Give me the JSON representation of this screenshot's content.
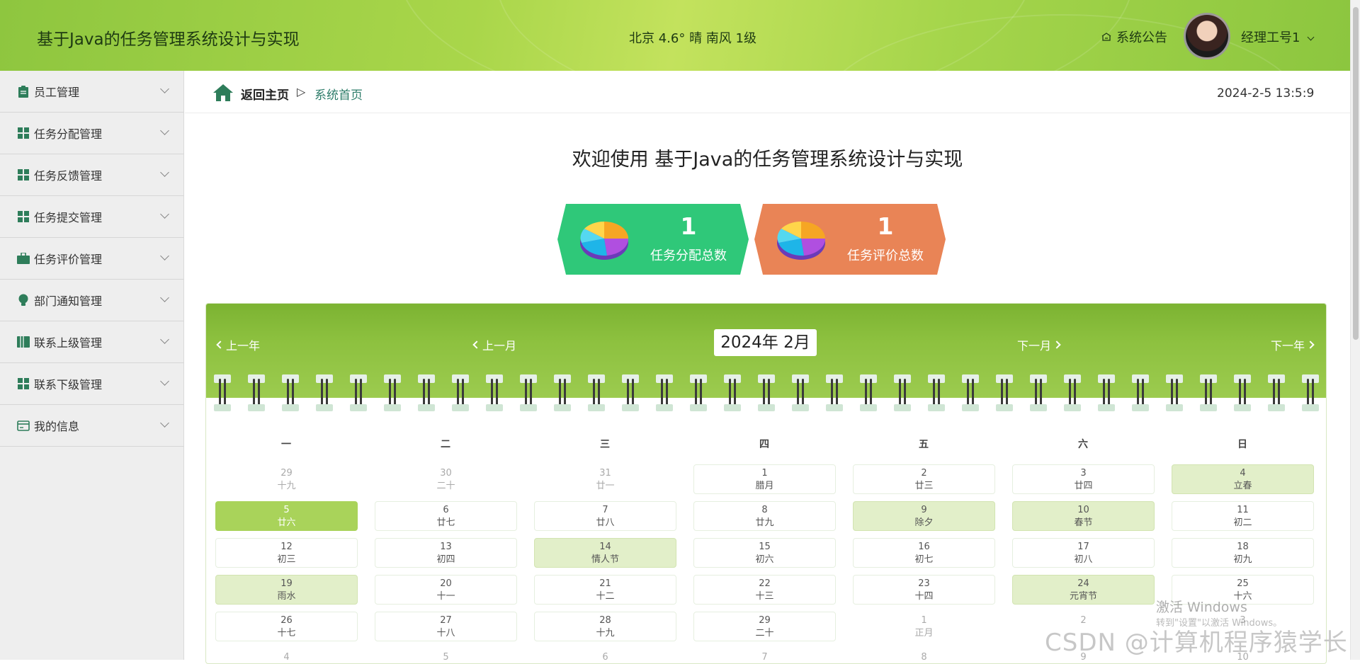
{
  "header": {
    "title": "基于Java的任务管理系统设计与实现",
    "weather": "北京 4.6° 晴 南风 1级",
    "notice_label": "系统公告",
    "user_label": "经理工号1"
  },
  "sidebar": {
    "items": [
      {
        "label": "员工管理",
        "icon": "clipboard-icon"
      },
      {
        "label": "任务分配管理",
        "icon": "grid-icon"
      },
      {
        "label": "任务反馈管理",
        "icon": "grid-icon"
      },
      {
        "label": "任务提交管理",
        "icon": "grid-icon"
      },
      {
        "label": "任务评价管理",
        "icon": "briefcase-icon"
      },
      {
        "label": "部门通知管理",
        "icon": "lightbulb-icon"
      },
      {
        "label": "联系上级管理",
        "icon": "book-icon"
      },
      {
        "label": "联系下级管理",
        "icon": "grid-icon"
      },
      {
        "label": "我的信息",
        "icon": "card-icon"
      }
    ]
  },
  "breadcrumb": {
    "home": "返回主页",
    "separator": "▷",
    "current": "系统首页",
    "datetime": "2024-2-5 13:5:9"
  },
  "welcome": "欢迎使用 基于Java的任务管理系统设计与实现",
  "stats": [
    {
      "value": "1",
      "label": "任务分配总数",
      "color": "#2fc879"
    },
    {
      "value": "1",
      "label": "任务评价总数",
      "color": "#e98456"
    }
  ],
  "calendar": {
    "prev_year": "上一年",
    "prev_month": "上一月",
    "month_title": "2024年 2月",
    "next_month": "下一月",
    "next_year": "下一年",
    "weekdays": [
      "一",
      "二",
      "三",
      "四",
      "五",
      "六",
      "日"
    ],
    "rows": [
      [
        {
          "d": "29",
          "l": "十九",
          "t": "other"
        },
        {
          "d": "30",
          "l": "二十",
          "t": "other"
        },
        {
          "d": "31",
          "l": "廿一",
          "t": "other"
        },
        {
          "d": "1",
          "l": "腊月",
          "t": ""
        },
        {
          "d": "2",
          "l": "廿三",
          "t": ""
        },
        {
          "d": "3",
          "l": "廿四",
          "t": ""
        },
        {
          "d": "4",
          "l": "立春",
          "t": "light"
        }
      ],
      [
        {
          "d": "5",
          "l": "廿六",
          "t": "today"
        },
        {
          "d": "6",
          "l": "廿七",
          "t": ""
        },
        {
          "d": "7",
          "l": "廿八",
          "t": ""
        },
        {
          "d": "8",
          "l": "廿九",
          "t": ""
        },
        {
          "d": "9",
          "l": "除夕",
          "t": "light"
        },
        {
          "d": "10",
          "l": "春节",
          "t": "light"
        },
        {
          "d": "11",
          "l": "初二",
          "t": ""
        }
      ],
      [
        {
          "d": "12",
          "l": "初三",
          "t": ""
        },
        {
          "d": "13",
          "l": "初四",
          "t": ""
        },
        {
          "d": "14",
          "l": "情人节",
          "t": "light"
        },
        {
          "d": "15",
          "l": "初六",
          "t": ""
        },
        {
          "d": "16",
          "l": "初七",
          "t": ""
        },
        {
          "d": "17",
          "l": "初八",
          "t": ""
        },
        {
          "d": "18",
          "l": "初九",
          "t": ""
        }
      ],
      [
        {
          "d": "19",
          "l": "雨水",
          "t": "light"
        },
        {
          "d": "20",
          "l": "十一",
          "t": ""
        },
        {
          "d": "21",
          "l": "十二",
          "t": ""
        },
        {
          "d": "22",
          "l": "十三",
          "t": ""
        },
        {
          "d": "23",
          "l": "十四",
          "t": ""
        },
        {
          "d": "24",
          "l": "元宵节",
          "t": "light"
        },
        {
          "d": "25",
          "l": "十六",
          "t": ""
        }
      ],
      [
        {
          "d": "26",
          "l": "十七",
          "t": ""
        },
        {
          "d": "27",
          "l": "十八",
          "t": ""
        },
        {
          "d": "28",
          "l": "十九",
          "t": ""
        },
        {
          "d": "29",
          "l": "二十",
          "t": ""
        },
        {
          "d": "1",
          "l": "正月",
          "t": "other"
        },
        {
          "d": "2",
          "l": "",
          "t": "other"
        },
        {
          "d": "3",
          "l": "",
          "t": "other"
        }
      ],
      [
        {
          "d": "4",
          "l": "",
          "t": "other"
        },
        {
          "d": "5",
          "l": "",
          "t": "other"
        },
        {
          "d": "6",
          "l": "",
          "t": "other"
        },
        {
          "d": "7",
          "l": "",
          "t": "other"
        },
        {
          "d": "8",
          "l": "",
          "t": "other"
        },
        {
          "d": "9",
          "l": "",
          "t": "other"
        },
        {
          "d": "10",
          "l": "",
          "t": "other"
        }
      ]
    ]
  },
  "overlay": {
    "activate_title": "激活 Windows",
    "activate_sub": "转到\"设置\"以激活 Windows。",
    "csdn": "CSDN @计算机程序猿学长"
  }
}
